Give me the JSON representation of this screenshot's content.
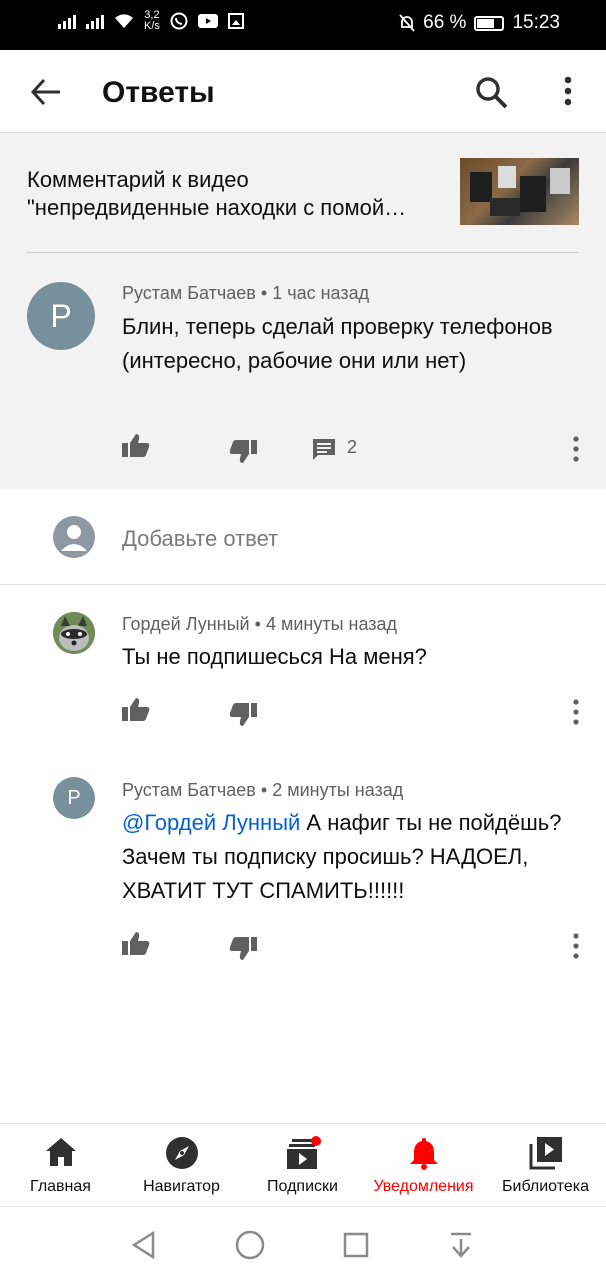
{
  "status_bar": {
    "net_speed_top": "3,2",
    "net_speed_unit": "K/s",
    "battery_percent": "66 %",
    "time": "15:23"
  },
  "app_bar": {
    "title": "Ответы"
  },
  "parent": {
    "video_caption_line1": "Комментарий к видео",
    "video_caption_line2": "\"непредвиденные находки с помой…",
    "comment": {
      "avatar_letter": "Р",
      "avatar_color": "#78909c",
      "author": "Рустам Батчаев",
      "time": "1 час назад",
      "text": "Блин, теперь сделай проверку телефонов (интересно, рабочие они или нет)",
      "reply_count": "2"
    }
  },
  "add_reply": {
    "placeholder": "Добавьте ответ"
  },
  "replies": [
    {
      "author": "Гордей Лунный",
      "time": "4 минуты назад",
      "text": "Ты не подпишесься На меня?"
    },
    {
      "avatar_letter": "Р",
      "author": "Рустам Батчаев",
      "time": "2 минуты назад",
      "mention": "@Гордей Лунный",
      "text": " А нафиг ты не пойдёшь? Зачем ты подписку  просишь? НАДОЕЛ, ХВАТИТ ТУТ СПАМИТЬ!!!!!!"
    }
  ],
  "bottom_nav": {
    "home": "Главная",
    "explore": "Навигатор",
    "subscriptions": "Подписки",
    "notifications": "Уведомления",
    "library": "Библиотека"
  },
  "colors": {
    "accent_red": "#ff0000",
    "mention_blue": "#065fd4"
  }
}
